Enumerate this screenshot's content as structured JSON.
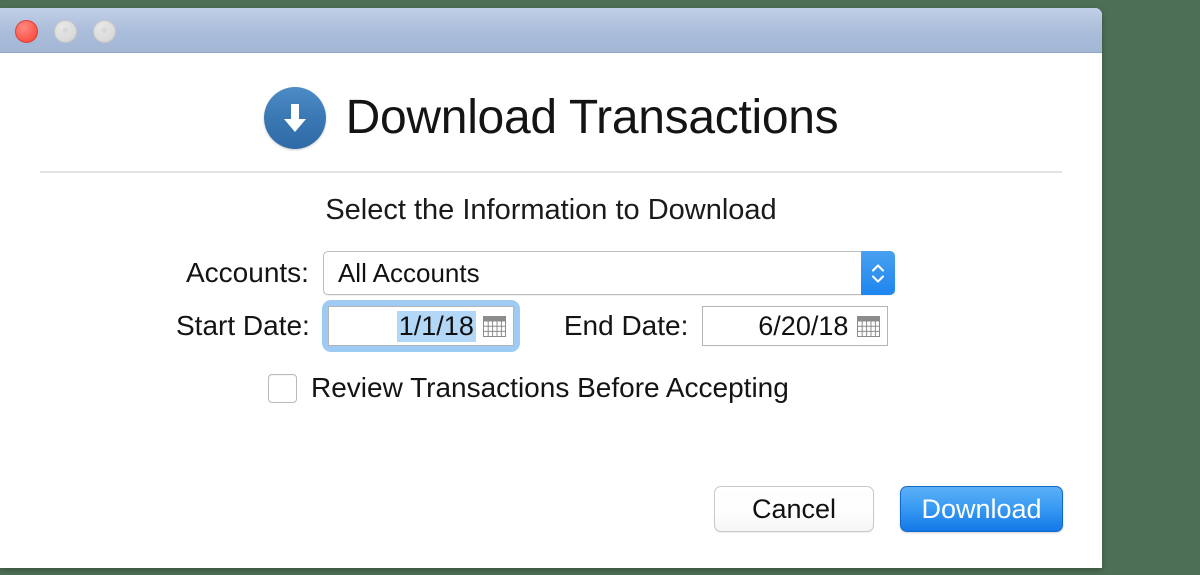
{
  "window": {
    "traffic_lights": [
      {
        "name": "close",
        "color": "#fc5d52"
      },
      {
        "name": "minimize",
        "color": "#dcdcdc"
      },
      {
        "name": "maximize",
        "color": "#dcdcdc"
      }
    ]
  },
  "header": {
    "icon": "download-circle-icon",
    "title": "Download Transactions",
    "subtitle": "Select the Information to Download"
  },
  "form": {
    "accounts": {
      "label": "Accounts:",
      "value": "All Accounts",
      "options": [
        "All Accounts"
      ],
      "stepper_icon": "chevron-up-down-icon"
    },
    "start_date": {
      "label": "Start Date:",
      "value": "1/1/18",
      "focused": true,
      "selected": true,
      "calendar_icon": "calendar-icon"
    },
    "end_date": {
      "label": "End Date:",
      "value": "6/20/18",
      "focused": false,
      "selected": false,
      "calendar_icon": "calendar-icon"
    },
    "review": {
      "label": "Review Transactions Before Accepting",
      "checked": false
    }
  },
  "buttons": {
    "cancel": "Cancel",
    "download": "Download"
  },
  "colors": {
    "desktop_background": "#4d7054",
    "titlebar_top": "#c2d0e8",
    "titlebar_bottom": "#a3b7d6",
    "accent_blue": "#1e86ef",
    "download_button_top": "#5cb0f7",
    "download_button_bottom": "#1478e8",
    "icon_blue": "#3a78b4",
    "focus_ring": "#9ecbf4",
    "selection_highlight": "#b3d7f7"
  }
}
